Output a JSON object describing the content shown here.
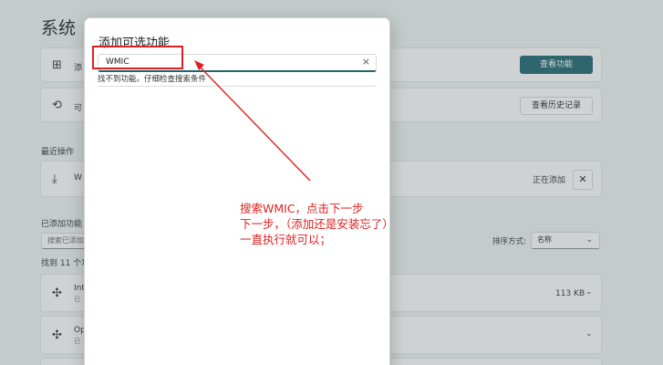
{
  "background": {
    "title": "系统",
    "card1": {
      "label": "添",
      "button": "查看功能"
    },
    "card2": {
      "label": "可",
      "button": "查看历史记录"
    },
    "recent": {
      "heading": "最近操作",
      "item_label": "W",
      "status": "正在添加"
    },
    "added": {
      "heading": "已添加功能",
      "search_placeholder": "搜索已添加",
      "sort_label": "排序方式:",
      "sort_value": "名称",
      "found": "找到 11 个功",
      "items": [
        {
          "name": "Int",
          "sub": "已",
          "size": "113 KB"
        },
        {
          "name": "Op",
          "sub": "已",
          "size": ""
        }
      ]
    }
  },
  "dialog": {
    "title": "添加可选功能",
    "search_value": "WMIC",
    "no_result": "找不到功能。仔细检查搜索条件"
  },
  "annotation": {
    "lines": [
      "搜索WMIC，点击下一步",
      "下一步，（添加还是安装忘了）",
      "一直执行就可以；"
    ],
    "color": "#e02020"
  },
  "icons": {
    "add_feature": "grid-plus-icon",
    "history": "history-icon",
    "download": "download-icon",
    "close": "close-icon",
    "chevron": "chevron-down-icon",
    "puzzle": "puzzle-icon"
  }
}
